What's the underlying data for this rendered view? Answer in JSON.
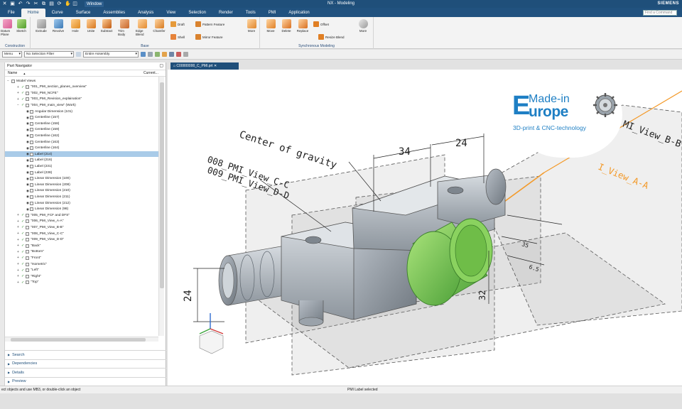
{
  "titlebar": {
    "window_label": "Window",
    "app_title": "NX - Modeling",
    "brand": "SIEMENS"
  },
  "menu": {
    "tabs": [
      "File",
      "Home",
      "Curve",
      "Surface",
      "Assemblies",
      "Analysis",
      "View",
      "Selection",
      "Render",
      "Tools",
      "PMI",
      "Application"
    ],
    "active": "Home",
    "command_finder_placeholder": "Find a Command"
  },
  "ribbon": {
    "groups": {
      "construction": "Construction",
      "base": "Base",
      "sync": "Synchronous Modeling"
    },
    "buttons": {
      "datum": "Datum Plane",
      "sketch": "Sketch",
      "extrude": "Extrude",
      "revolve": "Revolve",
      "hole": "Hole",
      "unite": "Unite",
      "subtract": "Subtract",
      "trim_body": "Trim Body",
      "edge_blend": "Edge Blend",
      "chamfer": "Chamfer",
      "draft": "Draft",
      "shell": "Shell",
      "pattern_feature": "Pattern Feature",
      "mirror_feature": "Mirror Feature",
      "more1": "More",
      "move": "Move",
      "delete": "Delete",
      "replace": "Replace",
      "offset": "Offset",
      "resize_blend": "Resize Blend",
      "more2": "More"
    }
  },
  "selection_bar": {
    "menu": "Menu",
    "filter": "No Selection Filter",
    "scope": "Entire Assembly"
  },
  "navigator": {
    "title": "Part Navigator",
    "col_name": "Name",
    "col_current": "Current...",
    "rows": [
      "Model Views",
      "\"001_PMI_section_planes_overview\"",
      "\"002_PMI_NCFE\"",
      "\"003_PMI_Revision_explaination\"",
      "\"004_PMI_main_view\" (Work)",
      "Angular Dimension (101)",
      "Centerline (157)",
      "Centerline (158)",
      "Centerline (159)",
      "Centerline (162)",
      "Centerline (163)",
      "Centerline (164)",
      "Label (214)",
      "Label (216)",
      "Label (231)",
      "Label (238)",
      "Linear Dimension (100)",
      "Linear Dimension (208)",
      "Linear Dimension (210)",
      "Linear Dimension (211)",
      "Linear Dimension (212)",
      "Linear Dimension (98)",
      "\"005_PMI_FCF and DFS\"",
      "\"006_PMI_View_A-A\"",
      "\"007_PMI_View_B-B\"",
      "\"008_PMI_View_C-C\"",
      "\"009_PMI_View_D-D\"",
      "\"Back\"",
      "\"Bottom\"",
      "\"Front\"",
      "\"Isometric\"",
      "\"Left\"",
      "\"Right\"",
      "\"Top\""
    ],
    "selected_row": "Label (214)",
    "sections": [
      "Search",
      "Dependencies",
      "Details",
      "Preview"
    ]
  },
  "document_tab": "C00000000_C_PMI.prt",
  "viewport": {
    "annotations": {
      "center_gravity": "Center of gravity",
      "view_c": "008_PMI_View_C-C",
      "view_d": "009_PMI_View_D-D",
      "view_b": "MI_View_B-B",
      "view_a": "I_View_A-A",
      "dim_34": "34",
      "dim_24_top": "24",
      "dim_24_left": "24",
      "dim_32": "32",
      "dim_35": "35",
      "dim_65": "6.5"
    }
  },
  "logo": {
    "line1": "Made-in",
    "line2": "urope",
    "big_letter": "E",
    "tagline": "3D-print & CNC-technology"
  },
  "status": {
    "left": "ect objects and use MB3, or double-click an object",
    "center": "PMI Label selected"
  },
  "colors": {
    "title_bg": "#1f4f7a",
    "selected_face": "#7fcf5a",
    "logo_blue": "#1e7fc4",
    "annotation_orange": "#f39a2a"
  }
}
